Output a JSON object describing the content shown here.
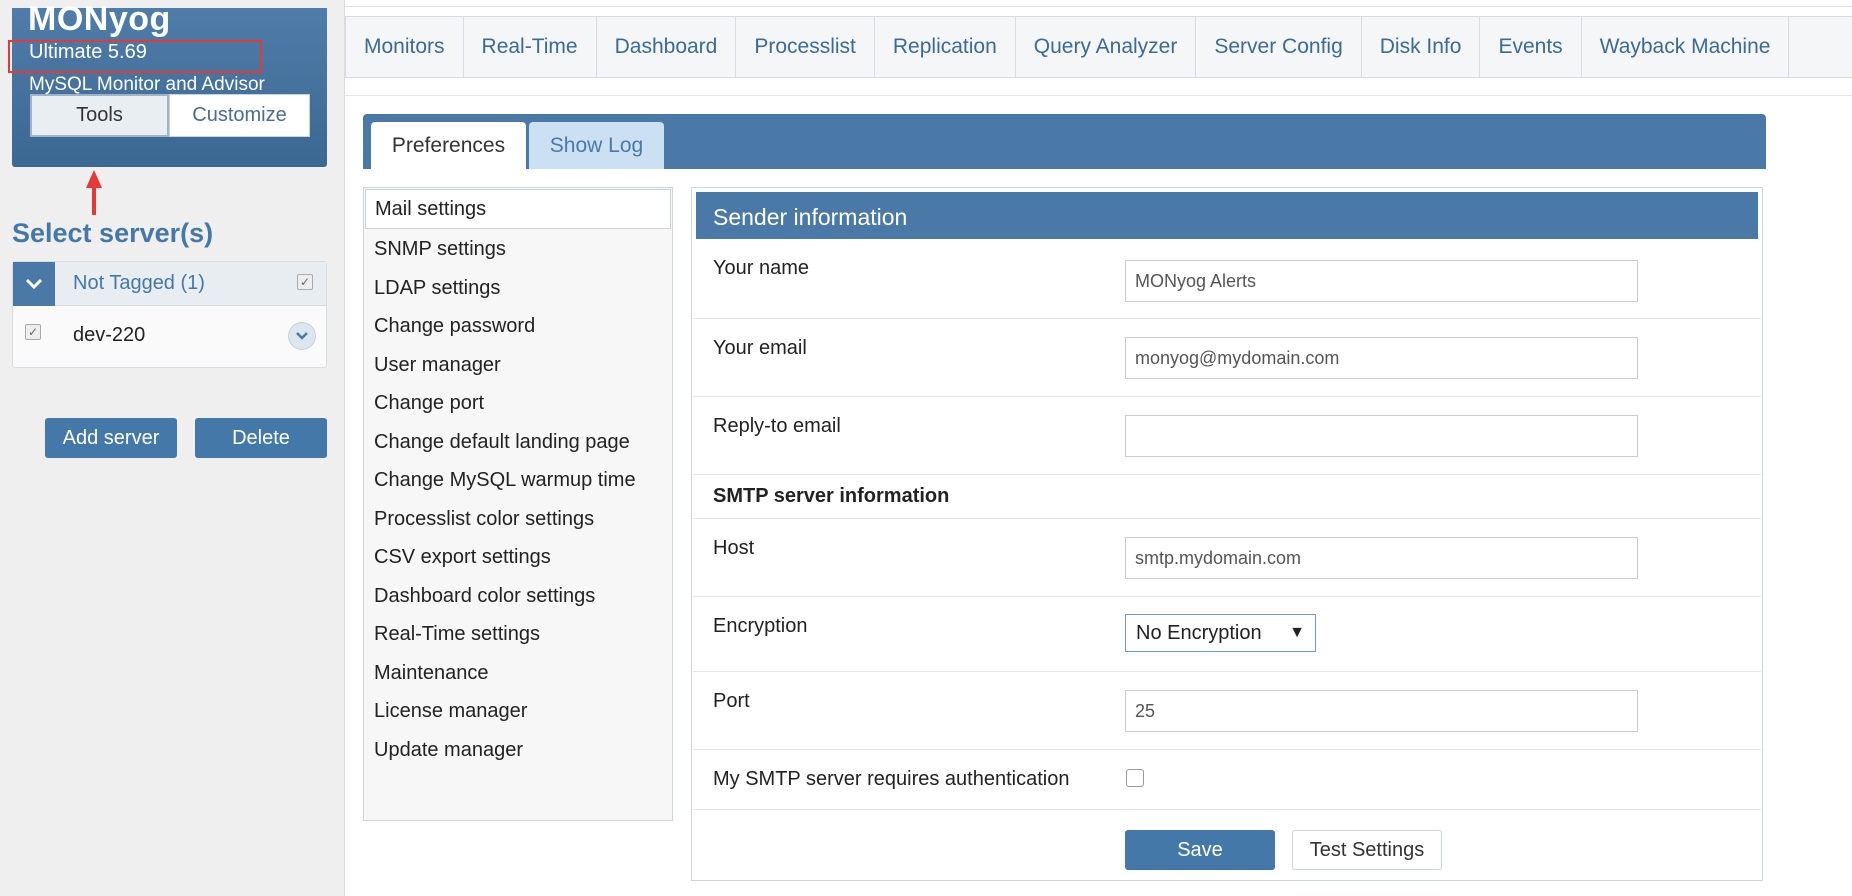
{
  "brand": {
    "title": "MONyog",
    "version": "Ultimate 5.69",
    "subtitle": "MySQL Monitor and Advisor",
    "tools_label": "Tools",
    "customize_label": "Customize"
  },
  "servers": {
    "title": "Select server(s)",
    "group_label": "Not Tagged (1)",
    "items": [
      {
        "label": "dev-220"
      }
    ],
    "add_label": "Add server",
    "delete_label": "Delete"
  },
  "nav": {
    "items": [
      "Monitors",
      "Real-Time",
      "Dashboard",
      "Processlist",
      "Replication",
      "Query Analyzer",
      "Server Config",
      "Disk Info",
      "Events",
      "Wayback Machine"
    ]
  },
  "tabs": {
    "preferences": "Preferences",
    "show_log": "Show Log"
  },
  "settings_list": [
    "Mail settings",
    "SNMP settings",
    "LDAP settings",
    "Change password",
    "User manager",
    "Change port",
    "Change default landing page",
    "Change MySQL warmup time",
    "Processlist color settings",
    "CSV export settings",
    "Dashboard color settings",
    "Real-Time settings",
    "Maintenance",
    "License manager",
    "Update manager"
  ],
  "form": {
    "header": "Sender information",
    "your_name_label": "Your name",
    "your_name_value": "MONyog Alerts",
    "your_email_label": "Your email",
    "your_email_value": "monyog@mydomain.com",
    "reply_to_label": "Reply-to email",
    "reply_to_value": "",
    "smtp_section": "SMTP server information",
    "host_label": "Host",
    "host_value": "smtp.mydomain.com",
    "encryption_label": "Encryption",
    "encryption_value": "No Encryption",
    "port_label": "Port",
    "port_value": "25",
    "auth_label": "My SMTP server requires authentication",
    "save_label": "Save",
    "test_label": "Test Settings"
  },
  "colors": {
    "accent": "#4a79a7",
    "highlight": "#e53935"
  }
}
